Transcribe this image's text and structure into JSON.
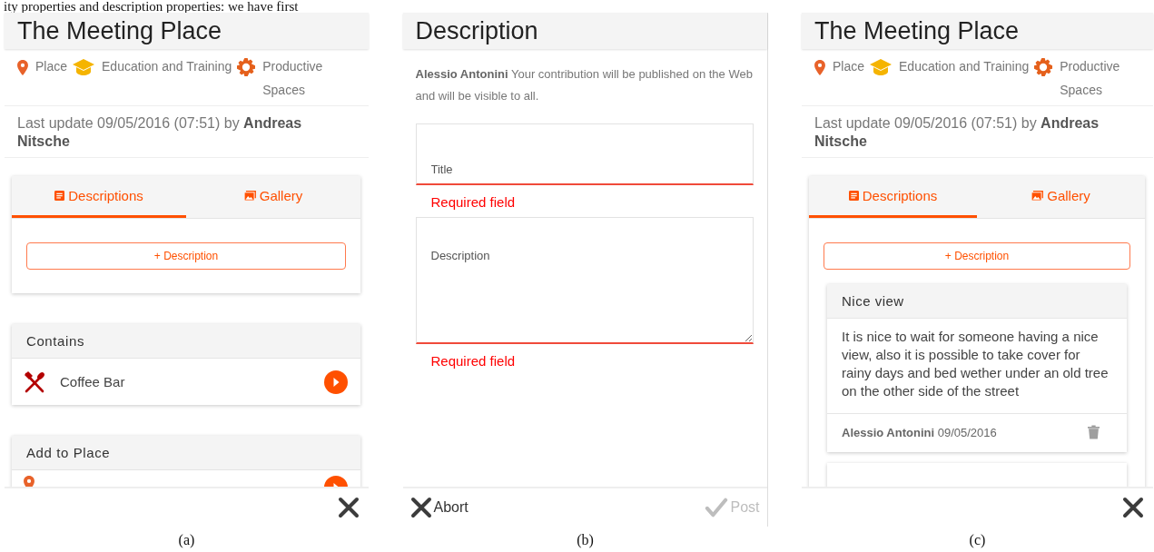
{
  "top_text": "ity properties and description properties: we have first",
  "panels": [
    {
      "kind": "place",
      "caption": "(a)",
      "title": "The Meeting Place",
      "categories": [
        {
          "kind": "place",
          "label": "Place"
        },
        {
          "kind": "education",
          "label": "Education and Training"
        },
        {
          "kind": "productive",
          "label": "Productive Spaces"
        }
      ],
      "last_update": "Last update 09/05/2016 (07:51) by **Andreas Nitsche**",
      "tabs": [
        {
          "kind": "descriptions",
          "label": "Descriptions",
          "selected": true
        },
        {
          "kind": "gallery",
          "label": "Gallery",
          "selected": false
        }
      ],
      "add_button": "+ Description",
      "sections": [
        {
          "title": "Contains",
          "items": [
            {
              "kind": "food",
              "label": "Coffee Bar"
            }
          ]
        },
        {
          "title": "Add to Place",
          "items": [
            {
              "kind": "place"
            }
          ]
        }
      ]
    },
    {
      "kind": "form",
      "caption": "(b)",
      "title": "Description",
      "notice": "**Alessio Antonini** Your contribution will be published on the Web and will be visible to all.",
      "fields": [
        {
          "kind": "input",
          "placeholder": "Title",
          "error": "Required field"
        },
        {
          "kind": "textarea",
          "placeholder": "Description",
          "error": "Required field"
        }
      ],
      "actions": [
        {
          "kind": "abort",
          "label": "Abort",
          "disabled": false
        },
        {
          "kind": "post",
          "label": "Post",
          "disabled": true
        }
      ]
    },
    {
      "kind": "place",
      "caption": "(c)",
      "title": "The Meeting Place",
      "categories": [
        {
          "kind": "place",
          "label": "Place"
        },
        {
          "kind": "education",
          "label": "Education and Training"
        },
        {
          "kind": "productive",
          "label": "Productive Spaces"
        }
      ],
      "last_update": "Last update 09/05/2016 (07:51) by **Andreas Nitsche**",
      "tabs": [
        {
          "kind": "descriptions",
          "label": "Descriptions",
          "selected": true
        },
        {
          "kind": "gallery",
          "label": "Gallery",
          "selected": false
        }
      ],
      "add_button": "+ Description",
      "descriptions": [
        {
          "title": "Nice view",
          "body": "It is nice to wait for someone having a nice view, also it is possible to take cover for rainy days and bed wether under an old tree on the other side of the street",
          "author": "Alessio Antonini",
          "date": "09/05/2016"
        }
      ],
      "more_below": true
    }
  ]
}
